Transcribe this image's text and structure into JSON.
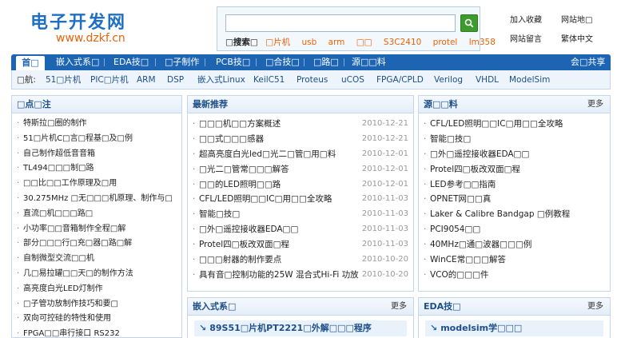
{
  "logo": {
    "cn": "电子开发网",
    "en": "www.dzkf.cn"
  },
  "search": {
    "placeholder": "",
    "hot_label": "□搜索□",
    "hot_words": [
      "□片机",
      "usb",
      "arm",
      "□□",
      "S3C2410",
      "protel",
      "lm358"
    ]
  },
  "top_links": [
    "加入收藏",
    "网站地□",
    "网站留言",
    "繁体中文"
  ],
  "nav": {
    "home": "首□",
    "items": [
      "嵌入式系□",
      "EDA技□",
      "□子制作",
      "PCB技□",
      "□合技□",
      "□路□",
      "源□□料"
    ],
    "right": "会□共享"
  },
  "subnav": {
    "label": "□航:",
    "items": [
      "51□片机",
      "PIC□片机",
      "ARM",
      "DSP",
      "嵌入式Linux",
      "KeilC51",
      "Proteus",
      "uCOS",
      "FPGA/CPLD",
      "Verilog",
      "VHDL",
      "ModelSim"
    ]
  },
  "left_panel": {
    "title": "□点□注",
    "items": [
      "特斯拉□圈的制作",
      "51□片机C□言□程基□及□例",
      "自己制作超低音音箱",
      "TL494□□□制□路",
      "□□比□□工作原理及□用",
      "30.275MHz □无□□□机原理、制作与□",
      "直流□机□□□路□",
      "小功率□□音箱制作全程□解",
      "部分□□□行□充□器□路□解",
      "自制微型交流□□机",
      "几□易拉罐□□天□的制作方法",
      "高亮度白光LED灯制作",
      "□子管功放制作技巧和要□",
      "双向可控硅的特性和使用",
      "FPGA□□串行接口 RS232"
    ]
  },
  "mid_panel": {
    "title": "最新推荐",
    "items": [
      {
        "text": "□□□机□□方案概述",
        "date": "2010-12-21"
      },
      {
        "text": "□□式□□□感器",
        "date": "2010-12-21"
      },
      {
        "text": "超高亮度白光led□光二□管□用□料",
        "date": "2010-12-01"
      },
      {
        "text": "□光二□管常□□□解答",
        "date": "2010-12-01"
      },
      {
        "text": "□□的LED照明□□路",
        "date": "2010-12-01"
      },
      {
        "text": "CFL/LED照明□□IC□用□□全攻略",
        "date": "2010-11-03"
      },
      {
        "text": "智能□技□",
        "date": "2010-11-03"
      },
      {
        "text": "□外□遥控接收器EDA□□",
        "date": "2010-11-03"
      },
      {
        "text": "Protel四□板改双面□程",
        "date": "2010-11-03"
      },
      {
        "text": "□□□射器的制作要点",
        "date": "2010-10-20"
      },
      {
        "text": "具有音□控制功能的25W 混合式Hi-Fi 功放",
        "date": "2010-10-20"
      }
    ]
  },
  "right_panel": {
    "title": "源□□料",
    "more": "更多",
    "items": [
      "CFL/LED照明□□IC□用□□全攻略",
      "智能□技□",
      "□外□遥控接收器EDA□□",
      "Protel四□板改双面□程",
      "LED参考□□指南",
      "OPNET网□□真",
      "Laker & Calibre Bandgap □例教程",
      "PCI9054□□",
      "40MHz□通□波器□□□例",
      "WinCE常□□□解答",
      "VCO的□□□件"
    ]
  },
  "bottom_mid": {
    "title": "嵌入式系□",
    "more": "更多",
    "feature": "89S51□片机PT2221□外解□□□程序"
  },
  "bottom_right": {
    "title": "EDA技□",
    "more": "更多",
    "feature": "modelsim学□□□"
  }
}
